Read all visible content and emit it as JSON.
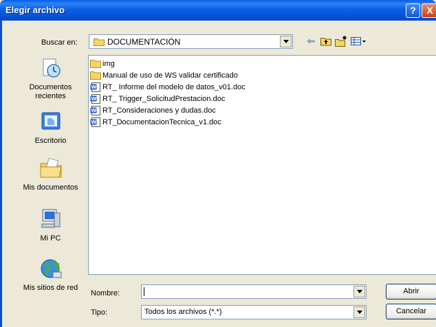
{
  "window": {
    "title": "Elegir archivo",
    "help_glyph": "?",
    "close_glyph": "X"
  },
  "lookin": {
    "label": "Buscar en:",
    "value": "DOCUMENTACIÓN"
  },
  "toolbar": {
    "icons": [
      "back-arrow-icon",
      "up-folder-icon",
      "new-folder-icon",
      "view-menu-icon"
    ]
  },
  "places": [
    {
      "label": "Documentos recientes",
      "icon": "recent-documents-icon"
    },
    {
      "label": "Escritorio",
      "icon": "desktop-icon"
    },
    {
      "label": "Mis documentos",
      "icon": "my-documents-icon"
    },
    {
      "label": "Mi PC",
      "icon": "my-computer-icon"
    },
    {
      "label": "Mis sitios de red",
      "icon": "network-places-icon"
    }
  ],
  "files": [
    {
      "name": "img",
      "type": "folder"
    },
    {
      "name": "Manual de uso de WS validar certificado",
      "type": "folder"
    },
    {
      "name": "RT_ Informe del modelo de datos_v01.doc",
      "type": "doc"
    },
    {
      "name": "RT_ Trigger_SolicitudPrestacion.doc",
      "type": "doc"
    },
    {
      "name": "RT_Consideraciones y dudas.doc",
      "type": "doc"
    },
    {
      "name": "RT_DocumentacionTecnica_v1.doc",
      "type": "doc"
    }
  ],
  "filename": {
    "label": "Nombre:",
    "value": ""
  },
  "filetype": {
    "label": "Tipo:",
    "value": "Todos los archivos (*.*)"
  },
  "buttons": {
    "open": "Abrir",
    "cancel": "Cancelar"
  },
  "colors": {
    "titlebar": "#0b60e8",
    "dialog_bg": "#ece9d8",
    "folder": "#f5d46a",
    "doc_blue": "#2a57c5"
  }
}
